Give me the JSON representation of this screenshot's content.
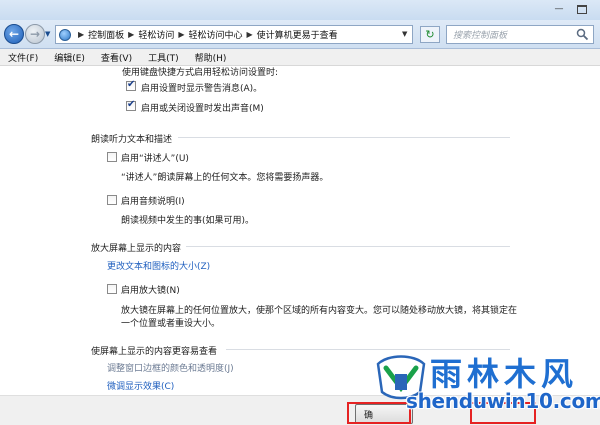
{
  "window": {
    "minimize_glyph": "—"
  },
  "address": {
    "breadcrumbs": [
      "控制面板",
      "轻松访问",
      "轻松访问中心",
      "使计算机更易于查看"
    ],
    "search_placeholder": "搜索控制面板"
  },
  "menu": [
    "文件(F)",
    "编辑(E)",
    "查看(V)",
    "工具(T)",
    "帮助(H)"
  ],
  "content": {
    "top_line": "使用键盘快捷方式启用轻松访问设置时:",
    "options_top": [
      {
        "label": "启用设置时显示警告消息(A)。",
        "checked": true
      },
      {
        "label": "启用或关闭设置时发出声音(M)",
        "checked": true
      }
    ],
    "section_narrator": {
      "heading": "朗读听力文本和描述",
      "narrator_label": "启用“讲述人”(U)",
      "narrator_checked": false,
      "narrator_desc": "“讲述人”朗读屏幕上的任何文本。您将需要扬声器。",
      "audio_label": "启用音频说明(I)",
      "audio_checked": false,
      "audio_desc": "朗读视频中发生的事(如果可用)。"
    },
    "section_magnify": {
      "heading": "放大屏幕上显示的内容",
      "change_size_link": "更改文本和图标的大小(Z)",
      "magnifier_label": "启用放大镜(N)",
      "magnifier_checked": false,
      "magnifier_desc_1": "放大镜在屏幕上的任何位置放大，使那个区域的所有内容变大。您可以随处移动放大镜，将其锁定在",
      "magnifier_desc_2": "一个位置或者重设大小。"
    },
    "section_easier": {
      "heading": "使屏幕上显示的内容更容易查看",
      "border_link": "调整窗口边框的颜色和透明度(J)",
      "fine_tune_link": "微调显示效果(C)"
    }
  },
  "buttons": {
    "ok_label": "确"
  },
  "watermark": {
    "title": "雨林木风",
    "url": "shenduwin10.com"
  },
  "colors": {
    "link": "#1f5fbf",
    "highlight": "#e52222",
    "watermark": "#1f6fd1"
  }
}
